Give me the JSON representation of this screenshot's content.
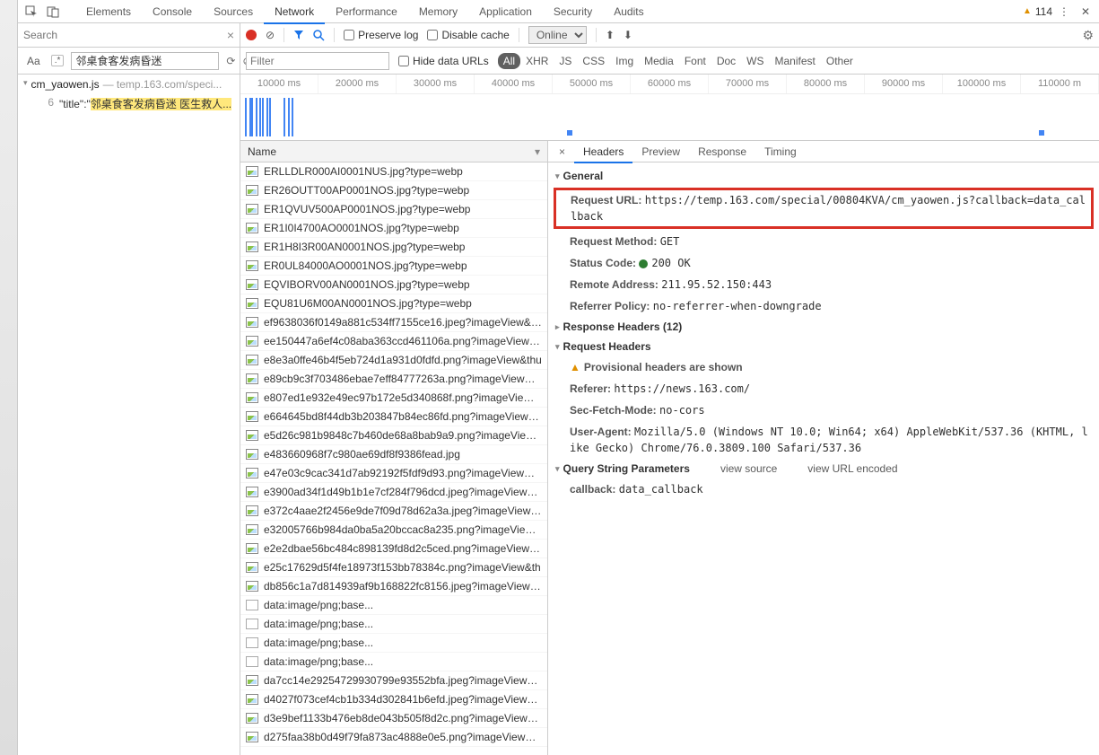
{
  "top_tabs": {
    "items": [
      "Elements",
      "Console",
      "Sources",
      "Network",
      "Performance",
      "Memory",
      "Application",
      "Security",
      "Audits"
    ],
    "active": 3,
    "warning_count": "114"
  },
  "search_panel": {
    "placeholder": "Search",
    "query": "邻桌食客发病昏迷",
    "result_file": {
      "name": "cm_yaowen.js",
      "path": "— temp.163.com/speci..."
    },
    "result_line_no": "6",
    "result_prefix": "\"title\":\"",
    "result_match": "邻桌食客发病昏迷 医生救人..."
  },
  "network_toolbar": {
    "preserve_log": "Preserve log",
    "disable_cache": "Disable cache",
    "throttle": "Online"
  },
  "filter_bar": {
    "placeholder": "Filter",
    "hide_data_urls": "Hide data URLs",
    "types": [
      "All",
      "XHR",
      "JS",
      "CSS",
      "Img",
      "Media",
      "Font",
      "Doc",
      "WS",
      "Manifest",
      "Other"
    ],
    "active": 0
  },
  "timeline_ticks": [
    "10000 ms",
    "20000 ms",
    "30000 ms",
    "40000 ms",
    "50000 ms",
    "60000 ms",
    "70000 ms",
    "80000 ms",
    "90000 ms",
    "100000 ms",
    "110000 m"
  ],
  "request_list": {
    "header": "Name",
    "rows": [
      {
        "icon": "img",
        "name": "ERLLDLR000AI0001NUS.jpg?type=webp"
      },
      {
        "icon": "img",
        "name": "ER26OUTT00AP0001NOS.jpg?type=webp"
      },
      {
        "icon": "img",
        "name": "ER1QVUV500AP0001NOS.jpg?type=webp"
      },
      {
        "icon": "img",
        "name": "ER1I0I4700AO0001NOS.jpg?type=webp"
      },
      {
        "icon": "img",
        "name": "ER1H8I3R00AN0001NOS.jpg?type=webp"
      },
      {
        "icon": "img",
        "name": "ER0UL84000AO0001NOS.jpg?type=webp"
      },
      {
        "icon": "img",
        "name": "EQVIBORV00AN0001NOS.jpg?type=webp"
      },
      {
        "icon": "img",
        "name": "EQU81U6M00AN0001NOS.jpg?type=webp"
      },
      {
        "icon": "img",
        "name": "ef9638036f0149a881c534ff7155ce16.jpeg?imageView&thu"
      },
      {
        "icon": "img",
        "name": "ee150447a6ef4c08aba363ccd461106a.png?imageView&thu"
      },
      {
        "icon": "img",
        "name": "e8e3a0ffe46b4f5eb724d1a931d0fdfd.png?imageView&thu"
      },
      {
        "icon": "img",
        "name": "e89cb9c3f703486ebae7eff84777263a.png?imageView&thu"
      },
      {
        "icon": "img",
        "name": "e807ed1e932e49ec97b172e5d340868f.png?imageView&thu"
      },
      {
        "icon": "img",
        "name": "e664645bd8f44db3b203847b84ec86fd.png?imageView&t..."
      },
      {
        "icon": "img",
        "name": "e5d26c981b9848c7b460de68a8bab9a9.png?imageView&t"
      },
      {
        "icon": "img",
        "name": "e483660968f7c980ae69df8f9386fead.jpg"
      },
      {
        "icon": "img",
        "name": "e47e03c9cac341d7ab92192f5fdf9d93.png?imageView&th..."
      },
      {
        "icon": "img",
        "name": "e3900ad34f1d49b1b1e7cf284f796dcd.jpeg?imageView&th"
      },
      {
        "icon": "img",
        "name": "e372c4aae2f2456e9de7f09d78d62a3a.jpeg?imageView&th"
      },
      {
        "icon": "img",
        "name": "e32005766b984da0ba5a20bccac8a235.png?imageView&t..."
      },
      {
        "icon": "img",
        "name": "e2e2dbae56bc484c898139fd8d2c5ced.png?imageView&th..."
      },
      {
        "icon": "img",
        "name": "e25c17629d5f4fe18973f153bb78384c.png?imageView&th"
      },
      {
        "icon": "img",
        "name": "db856c1a7d814939af9b168822fc8156.jpeg?imageView&th"
      },
      {
        "icon": "doc",
        "name": "data:image/png;base..."
      },
      {
        "icon": "doc",
        "name": "data:image/png;base..."
      },
      {
        "icon": "doc",
        "name": "data:image/png;base..."
      },
      {
        "icon": "doc",
        "name": "data:image/png;base..."
      },
      {
        "icon": "img",
        "name": "da7cc14e29254729930799e93552bfa.jpeg?imageView&th"
      },
      {
        "icon": "img",
        "name": "d4027f073cef4cb1b334d302841b6efd.jpeg?imageView&th"
      },
      {
        "icon": "img",
        "name": "d3e9bef1133b476eb8de043b505f8d2c.png?imageView&th"
      },
      {
        "icon": "img",
        "name": "d275faa38b0d49f79fa873ac4888e0e5.png?imageView&th."
      }
    ]
  },
  "detail_tabs": {
    "items": [
      "Headers",
      "Preview",
      "Response",
      "Timing"
    ],
    "active": 0
  },
  "headers": {
    "general_title": "General",
    "request_url_k": "Request URL:",
    "request_url_v": "https://temp.163.com/special/00804KVA/cm_yaowen.js?callback=data_callback",
    "request_method_k": "Request Method:",
    "request_method_v": "GET",
    "status_code_k": "Status Code:",
    "status_code_v": "200 OK",
    "remote_addr_k": "Remote Address:",
    "remote_addr_v": "211.95.52.150:443",
    "referrer_policy_k": "Referrer Policy:",
    "referrer_policy_v": "no-referrer-when-downgrade",
    "response_headers_title": "Response Headers (12)",
    "request_headers_title": "Request Headers",
    "provisional": "Provisional headers are shown",
    "referer_k": "Referer:",
    "referer_v": "https://news.163.com/",
    "sfm_k": "Sec-Fetch-Mode:",
    "sfm_v": "no-cors",
    "ua_k": "User-Agent:",
    "ua_v": "Mozilla/5.0 (Windows NT 10.0; Win64; x64) AppleWebKit/537.36 (KHTML, like Gecko) Chrome/76.0.3809.100 Safari/537.36",
    "qsp_title": "Query String Parameters",
    "view_source": "view source",
    "view_url": "view URL encoded",
    "callback_k": "callback:",
    "callback_v": "data_callback"
  }
}
